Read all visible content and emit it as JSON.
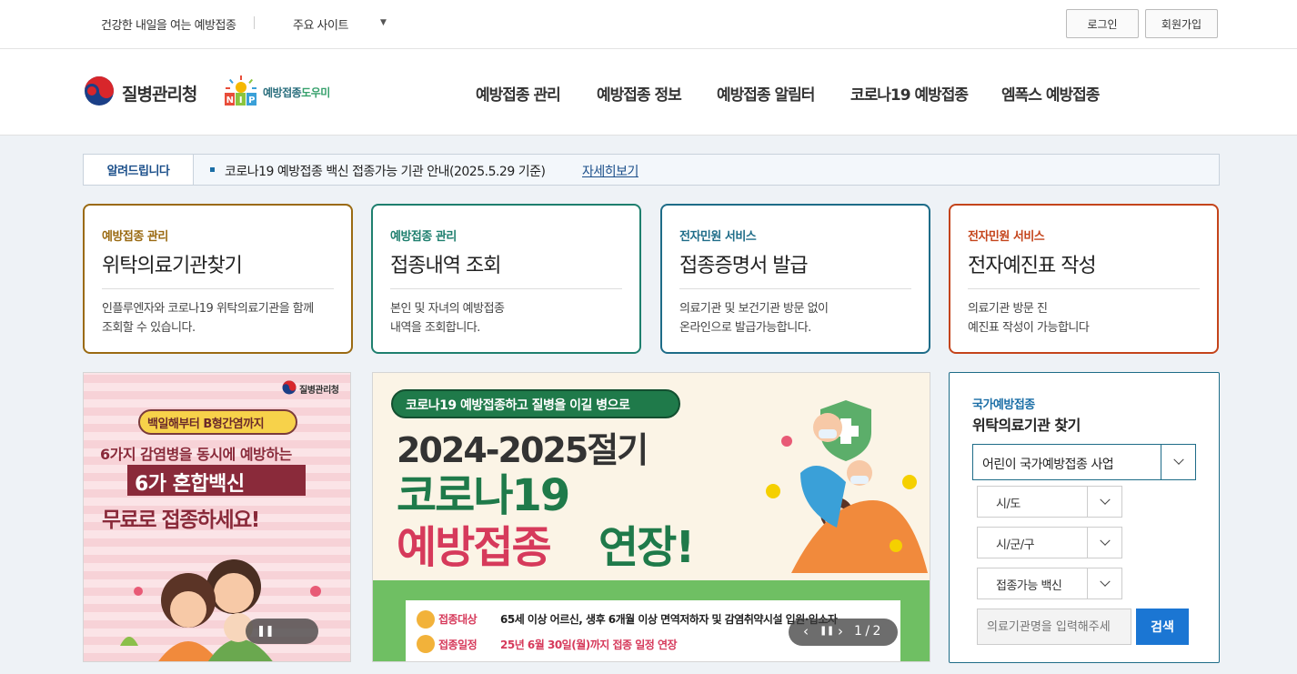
{
  "topbar": {
    "tagline": "건강한 내일을 여는 예방접종",
    "sites": "주요 사이트",
    "login": "로그인",
    "signup": "회원가입"
  },
  "header": {
    "kdca_name": "질병관리청",
    "ntp_name_a": "예방접종",
    "ntp_name_b": "도우미",
    "ntp_letters": "NIP",
    "nav": [
      "예방접종 관리",
      "예방접종 정보",
      "예방접종 알림터",
      "코로나19 예방접종",
      "엠폭스 예방접종"
    ]
  },
  "notice": {
    "label": "알려드립니다",
    "text": "코로나19 예방접종 백신 접종가능 기관 안내(2025.5.29 기준)",
    "more": "자세히보기"
  },
  "cards": [
    {
      "category": "예방접종 관리",
      "title": "위탁의료기관찾기",
      "desc1": "인플루엔자와 코로나19 위탁의료기관을 함께",
      "desc2": "조회할 수 있습니다.",
      "color": "#9a6a12"
    },
    {
      "category": "예방접종 관리",
      "title": "접종내역 조회",
      "desc1": "본인 및 자녀의 예방접종",
      "desc2": "내역을 조회합니다.",
      "color": "#1e7f6e"
    },
    {
      "category": "전자민원 서비스",
      "title": "접종증명서 발급",
      "desc1": "의료기관 및 보건기관 방문 없이",
      "desc2": "온라인으로 발급가능합니다.",
      "color": "#1e6c88"
    },
    {
      "category": "전자민원 서비스",
      "title": "전자예진표 작성",
      "desc1": "의료기관 방문 진",
      "desc2": "예진표 작성이 가능합니다",
      "color": "#c4441b"
    }
  ],
  "banner1": {
    "logo": "질병관리청",
    "line1": "백일해부터 B형간염까지",
    "line2": "6가지 감염병을 동시에 예방하는",
    "line3": "6가 혼합백신",
    "line4": "무료로 접종하세요!"
  },
  "banner2": {
    "pill": "코로나19 예방접종하고 질병을 이길 병으로",
    "season": "2024-2025절기",
    "covid": "코로나19",
    "vacc": "예방접종",
    "extend": "연장!",
    "target_label": "접종대상",
    "target_text": "65세 이상 어르신, 생후 6개월 이상 면역저하자 및 감염취약시설 입원·입소자",
    "period_label": "접종일정",
    "period_text": "25년 6월 30일(월)까지 접종 일정 연장",
    "page": "1 / 2"
  },
  "finder": {
    "subtitle": "국가예방접종",
    "title": "위탁의료기관 찾기",
    "program": "어린이 국가예방접종 사업",
    "sido": "시/도",
    "sigungu": "시/군/구",
    "vaccine": "접종가능 백신",
    "placeholder": "의료기관명을 입력해주세",
    "search": "검색"
  }
}
